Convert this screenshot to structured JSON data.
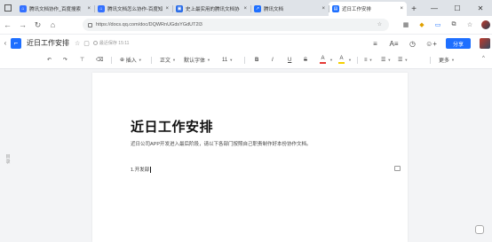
{
  "browser": {
    "tabs": [
      {
        "title": "腾讯文档协作_百度搜索",
        "fav_color": "#3370ff",
        "active": false
      },
      {
        "title": "腾讯文档怎么协作-百度知",
        "fav_color": "#3370ff",
        "active": false
      },
      {
        "title": "史上最实用的腾讯文档协",
        "fav_color": "#2b6de8",
        "active": false
      },
      {
        "title": "腾讯文档",
        "fav_color": "#1e6fff",
        "active": false
      },
      {
        "title": "近日工作安排",
        "fav_color": "#1e6fff",
        "active": true
      }
    ],
    "tab_close": "×",
    "new_tab": "+",
    "url": "https://docs.qq.com/doc/DQWRnUGdsYGdUT2l3",
    "window_controls": [
      "—",
      "☐",
      "✕"
    ]
  },
  "doc_header": {
    "title": "近日工作安排",
    "star": "☆",
    "save_status": "最近保存 15:11",
    "share_label": "分享",
    "icons": [
      "menu-icon",
      "font-icon",
      "history-icon",
      "add-user-icon"
    ]
  },
  "toolbar": {
    "undo": "↶",
    "redo": "↷",
    "format_painter": "⊤",
    "clear_format": "⌫",
    "insert_label": "插入",
    "style_label": "正文",
    "font_label": "默认字体",
    "size_label": "11",
    "bold": "B",
    "italic": "I",
    "underline": "U",
    "strike": "S",
    "font_color": "A",
    "highlight": "A",
    "align_left": "≡",
    "list_ordered": "☰",
    "list_unordered": "☰",
    "more_label": "更多",
    "font_color_hex": "#e53935",
    "highlight_hex": "#f5d000",
    "collapse": "^"
  },
  "document": {
    "heading": "近日工作安排",
    "intro": "近日公司APP开发进入最后阶段，请以下各部门按照自己职责制作好本份协作文档。",
    "items": [
      "1.开发部"
    ]
  },
  "sidebar": {
    "outline_label": "目录"
  }
}
